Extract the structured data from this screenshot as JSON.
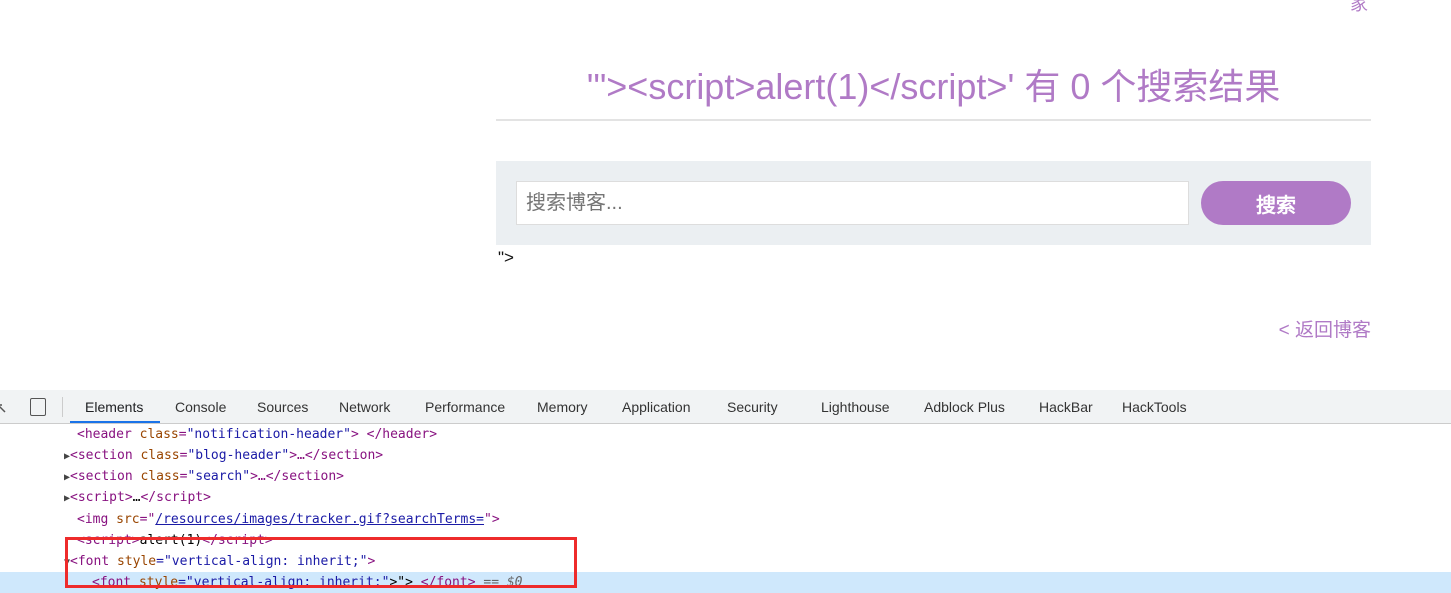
{
  "page": {
    "top_clipped_link": "家",
    "heading": "'\"><script>alert(1)</script>' 有 0 个搜索结果",
    "search": {
      "placeholder": "搜索博客...",
      "value": "",
      "button": "搜索"
    },
    "stray_text": "\">",
    "back_link": "< 返回博客"
  },
  "devtools": {
    "tabs": [
      "Elements",
      "Console",
      "Sources",
      "Network",
      "Performance",
      "Memory",
      "Application",
      "Security",
      "Lighthouse",
      "Adblock Plus",
      "HackBar",
      "HackTools"
    ],
    "active_tab": "Elements",
    "lines": {
      "l1": {
        "open": "<header ",
        "attr": "class",
        "val": "\"notification-header\"",
        "close": "> </header>"
      },
      "l2": {
        "open": "<section ",
        "attr": "class",
        "val": "\"blog-header\"",
        "close": ">…</section>"
      },
      "l3": {
        "open": "<section ",
        "attr": "class",
        "val": "\"search\"",
        "close": ">…</section>"
      },
      "l4": {
        "open": "<script>",
        "text": "…",
        "close": "</script>"
      },
      "l5": {
        "open": "<img ",
        "attr": "src",
        "eq": "=\"",
        "link": "/resources/images/tracker.gif?searchTerms=",
        "close": "\">"
      },
      "l6": {
        "open": "<script>",
        "text": "alert(1)",
        "close": "</script>"
      },
      "l7": {
        "open": "<font ",
        "attr": "style",
        "val": "=\"vertical-align: inherit;\"",
        "close": ">"
      },
      "l8": {
        "open": "<font ",
        "attr": "style",
        "val": "=\"vertical-align: inherit;\"",
        "text": ">\"> ",
        "close": "</font>",
        "marker": " == $0"
      }
    }
  },
  "colors": {
    "accent": "#b07ac6",
    "highlight": "#ee2b2b",
    "selection": "#cfe8fc"
  }
}
